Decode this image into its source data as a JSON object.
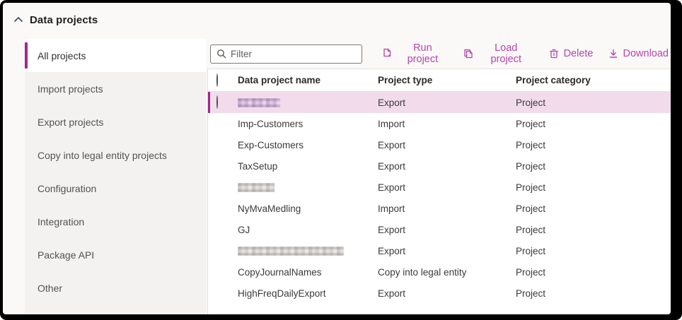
{
  "header": {
    "title": "Data projects",
    "collapse_icon": "chevron-up"
  },
  "colors": {
    "accent": "#B942B0",
    "selection_bar": "#A1268E",
    "selected_row_bg": "#F2DCEC",
    "sidebar_bg": "#F3F2F1",
    "frame": "#000000"
  },
  "sidebar": {
    "items": [
      {
        "label": "All projects",
        "selected": true
      },
      {
        "label": "Import projects",
        "selected": false
      },
      {
        "label": "Export projects",
        "selected": false
      },
      {
        "label": "Copy into legal entity projects",
        "selected": false
      },
      {
        "label": "Configuration",
        "selected": false
      },
      {
        "label": "Integration",
        "selected": false
      },
      {
        "label": "Package API",
        "selected": false
      },
      {
        "label": "Other",
        "selected": false
      }
    ]
  },
  "toolbar": {
    "filter": {
      "placeholder": "Filter",
      "value": "",
      "icon": "search-icon"
    },
    "buttons": [
      {
        "label": "Run project",
        "icon": "run-project-icon"
      },
      {
        "label": "Load project",
        "icon": "load-project-icon"
      },
      {
        "label": "Delete",
        "icon": "delete-icon"
      },
      {
        "label": "Download",
        "icon": "download-icon"
      }
    ]
  },
  "table": {
    "columns": [
      "Data project name",
      "Project type",
      "Project category"
    ],
    "rows": [
      {
        "name": "",
        "redacted": true,
        "redacted_width": 60,
        "type": "Export",
        "category": "Project",
        "selected": true
      },
      {
        "name": "Imp-Customers",
        "redacted": false,
        "type": "Import",
        "category": "Project",
        "selected": false
      },
      {
        "name": "Exp-Customers",
        "redacted": false,
        "type": "Export",
        "category": "Project",
        "selected": false
      },
      {
        "name": "TaxSetup",
        "redacted": false,
        "type": "Export",
        "category": "Project",
        "selected": false
      },
      {
        "name": "",
        "redacted": true,
        "redacted_width": 52,
        "type": "Export",
        "category": "Project",
        "selected": false
      },
      {
        "name": "NyMvaMedling",
        "redacted": false,
        "type": "Import",
        "category": "Project",
        "selected": false
      },
      {
        "name": "GJ",
        "redacted": false,
        "type": "Export",
        "category": "Project",
        "selected": false
      },
      {
        "name": "",
        "redacted": true,
        "redacted_width": 150,
        "type": "Export",
        "category": "Project",
        "selected": false
      },
      {
        "name": "CopyJournalNames",
        "redacted": false,
        "type": "Copy into legal entity",
        "category": "Project",
        "selected": false
      },
      {
        "name": "HighFreqDailyExport",
        "redacted": false,
        "type": "Export",
        "category": "Project",
        "selected": false
      }
    ]
  }
}
